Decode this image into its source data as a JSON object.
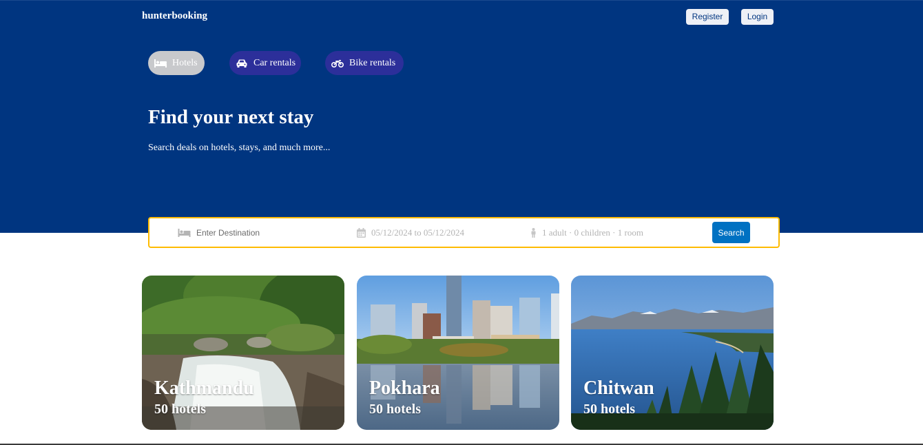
{
  "header": {
    "logo": "hunterbooking",
    "register_label": "Register",
    "login_label": "Login"
  },
  "tabs": [
    {
      "label": "Hotels",
      "icon": "bed-icon",
      "active": true
    },
    {
      "label": "Car rentals",
      "icon": "car-icon",
      "active": false
    },
    {
      "label": "Bike rentals",
      "icon": "motorcycle-icon",
      "active": false
    }
  ],
  "hero": {
    "title": "Find your next stay",
    "subtitle": "Search deals on hotels, stays, and much more..."
  },
  "search": {
    "destination_placeholder": "Enter Destination",
    "date_range": "05/12/2024 to 05/12/2024",
    "guests": "1 adult · 0 children · 1 room",
    "button_label": "Search",
    "destination_icon": "bed-icon",
    "date_icon": "calendar-icon",
    "guests_icon": "person-icon"
  },
  "cities": [
    {
      "name": "Kathmandu",
      "count": "50 hotels"
    },
    {
      "name": "Pokhara",
      "count": "50 hotels"
    },
    {
      "name": "Chitwan",
      "count": "50 hotels"
    }
  ],
  "colors": {
    "brand_blue": "#003580",
    "search_border": "#febb02",
    "search_button": "#0071c2",
    "tab_active": "#c8c9cc",
    "tab_inactive": "#2c2f9a"
  }
}
